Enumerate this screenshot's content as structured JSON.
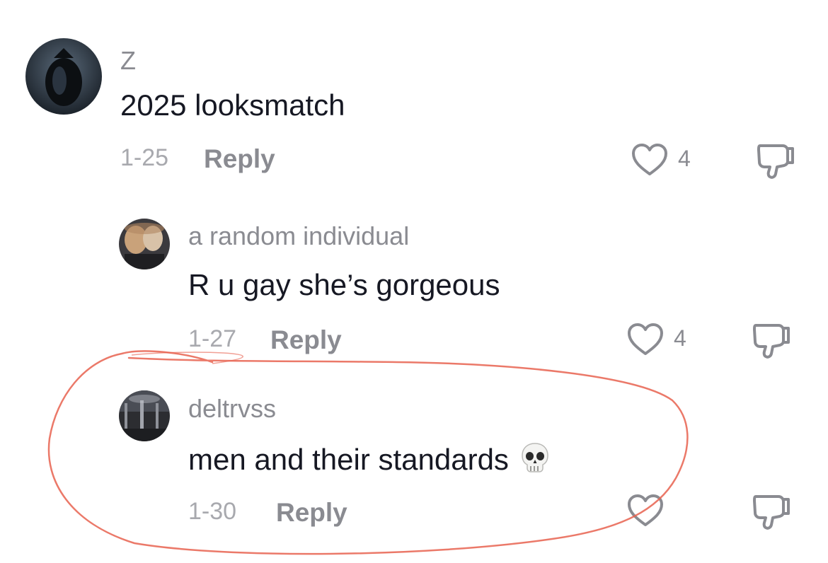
{
  "comments": [
    {
      "username": "Z",
      "text": "2025 looksmatch",
      "date": "1-25",
      "reply_label": "Reply",
      "likes": "4"
    },
    {
      "username": "a random individual",
      "text": "R u gay she’s gorgeous",
      "date": "1-27",
      "reply_label": "Reply",
      "likes": "4"
    },
    {
      "username": "deltrvss",
      "text": "men and their standards",
      "emoji": "skull-emoji",
      "date": "1-30",
      "reply_label": "Reply",
      "likes": ""
    }
  ],
  "icons": {
    "like": "heart-outline-icon",
    "dislike": "thumbs-down-icon"
  },
  "colors": {
    "annotation": "#e8614f",
    "username": "#8a8b91",
    "text": "#161823",
    "meta": "#a8a9ae"
  }
}
